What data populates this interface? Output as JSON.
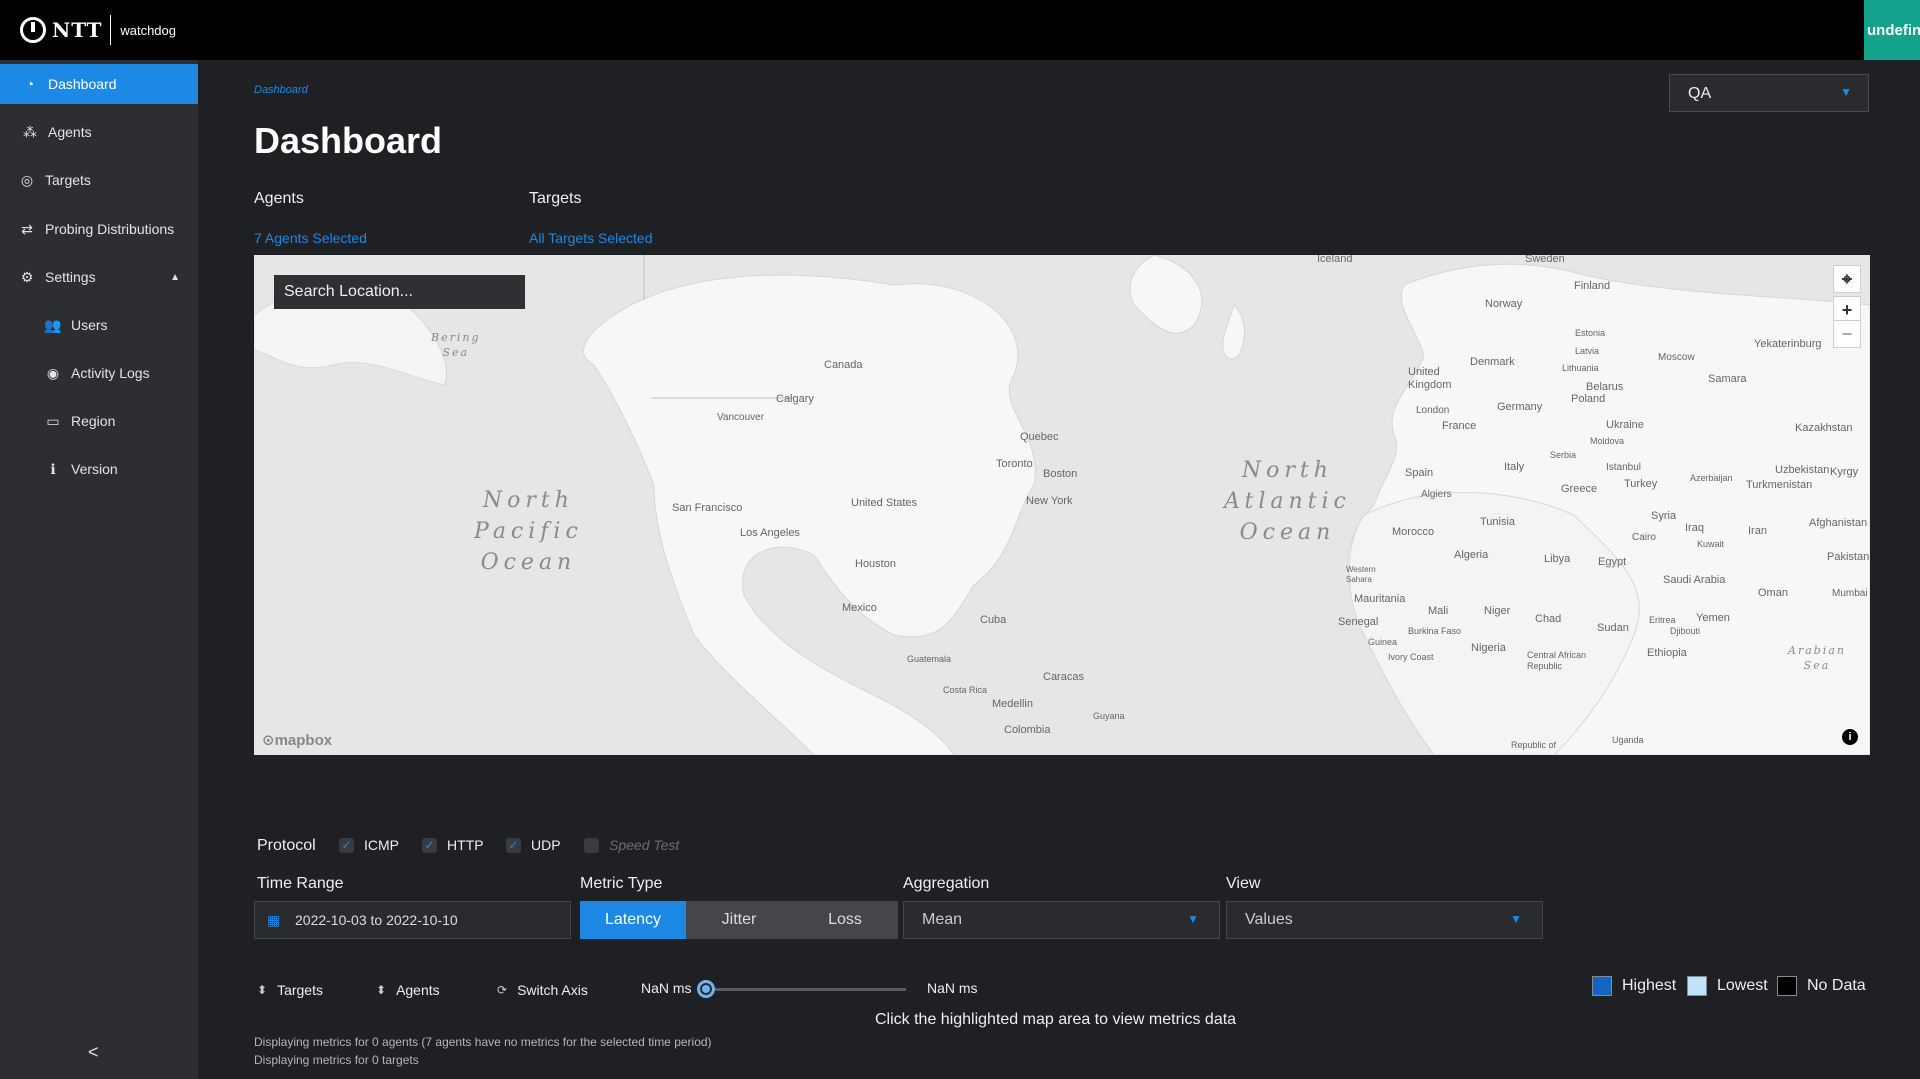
{
  "header": {
    "brand": "NTT",
    "app_name": "watchdog",
    "user_label": "undefined"
  },
  "sidebar": {
    "items": [
      {
        "label": "Dashboard",
        "icon": "gauge-icon"
      },
      {
        "label": "Agents",
        "icon": "network-icon"
      },
      {
        "label": "Targets",
        "icon": "target-icon"
      },
      {
        "label": "Probing Distributions",
        "icon": "arrows-icon"
      },
      {
        "label": "Settings",
        "icon": "gear-icon"
      },
      {
        "label": "Users",
        "icon": "users-icon"
      },
      {
        "label": "Activity Logs",
        "icon": "eye-icon"
      },
      {
        "label": "Region",
        "icon": "id-card-icon"
      },
      {
        "label": "Version",
        "icon": "info-icon"
      }
    ],
    "collapse_glyph": "<"
  },
  "breadcrumb": "Dashboard",
  "page_title": "Dashboard",
  "environment": {
    "selected": "QA"
  },
  "filters": {
    "agents_label": "Agents",
    "agents_value": "7 Agents Selected",
    "targets_label": "Targets",
    "targets_value": "All Targets Selected"
  },
  "map": {
    "search_placeholder": "Search Location...",
    "attribution": "mapbox",
    "oceans": [
      "North\nPacific\nOcean",
      "North\nAtlantic\nOcean",
      "Bering\nSea",
      "Arabian\nSea"
    ],
    "labels": [
      "Iceland",
      "Sweden",
      "Finland",
      "Norway",
      "Estonia",
      "Latvia",
      "Lithuania",
      "Denmark",
      "Moscow",
      "Yekaterinburg",
      "United Kingdom",
      "London",
      "Belarus",
      "Samara",
      "Germany",
      "Poland",
      "Ukraine",
      "Moldova",
      "France",
      "Kazakhstan",
      "Serbia",
      "Italy",
      "Istanbul",
      "Spain",
      "Uzbekistan",
      "Kyrgy",
      "Azerbaijan",
      "Turkmenistan",
      "Greece",
      "Turkey",
      "Algiers",
      "Tunisia",
      "Syria",
      "Iraq",
      "Afghanistan",
      "Iran",
      "Morocco",
      "Cairo",
      "Kuwait",
      "Pakistan",
      "Algeria",
      "Libya",
      "Egypt",
      "Western Sahara",
      "Saudi Arabia",
      "Oman",
      "Mumbai",
      "Mauritania",
      "Mali",
      "Niger",
      "Chad",
      "Sudan",
      "Eritrea",
      "Yemen",
      "Senegal",
      "Burkina Faso",
      "Djibouti",
      "Guinea",
      "Nigeria",
      "Ethiopia",
      "Ivory Coast",
      "Central African Republic",
      "Republic of",
      "Uganda",
      "Canada",
      "Calgary",
      "Vancouver",
      "Quebec",
      "Toronto",
      "Boston",
      "United States",
      "New York",
      "San Francisco",
      "Los Angeles",
      "Houston",
      "Mexico",
      "Cuba",
      "Guatemala",
      "Caracas",
      "Costa Rica",
      "Medellin",
      "Guyana",
      "Colombia"
    ]
  },
  "controls": {
    "protocol_label": "Protocol",
    "protocols": [
      {
        "label": "ICMP",
        "checked": true
      },
      {
        "label": "HTTP",
        "checked": true
      },
      {
        "label": "UDP",
        "checked": true
      },
      {
        "label": "Speed Test",
        "checked": false
      }
    ],
    "time_range_label": "Time Range",
    "time_range_value": "2022-10-03 to 2022-10-10",
    "metric_type_label": "Metric Type",
    "metric_types": [
      "Latency",
      "Jitter",
      "Loss"
    ],
    "metric_selected": "Latency",
    "aggregation_label": "Aggregation",
    "aggregation_value": "Mean",
    "view_label": "View",
    "view_value": "Values",
    "sort_targets": "Targets",
    "sort_agents": "Agents",
    "switch_axis": "Switch Axis",
    "slider_min": "NaN ms",
    "slider_max": "NaN ms",
    "hint": "Click the highlighted map area to view metrics data"
  },
  "legend": [
    {
      "label": "Highest",
      "color": "#1565c0"
    },
    {
      "label": "Lowest",
      "color": "#bfe3fb"
    },
    {
      "label": "No Data",
      "color": "#000000"
    }
  ],
  "status": {
    "agents_line": "Displaying metrics for 0 agents (7 agents have no metrics for the selected time period)",
    "targets_line": "Displaying metrics for 0 targets"
  }
}
